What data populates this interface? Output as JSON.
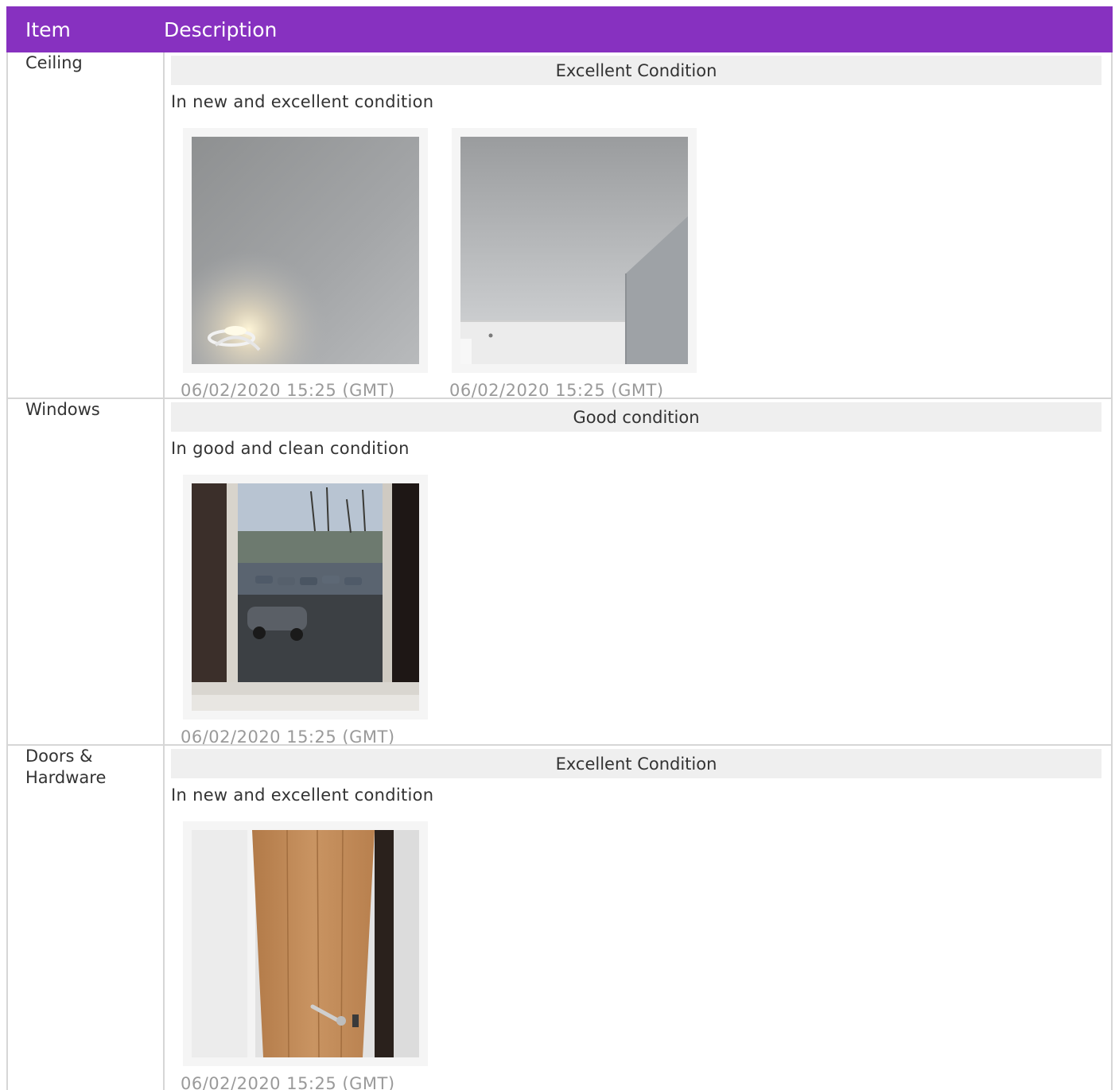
{
  "header": {
    "item_label": "Item",
    "description_label": "Description",
    "accent_color": "#8731c0"
  },
  "rows": [
    {
      "item": "Ceiling",
      "condition": "Excellent Condition",
      "description": "In new and excellent condition",
      "photos": [
        {
          "subject": "ceiling-with-light-fixture",
          "timestamp": "06/02/2020 15:25 (GMT)"
        },
        {
          "subject": "ceiling-corner",
          "timestamp": "06/02/2020 15:25 (GMT)"
        }
      ]
    },
    {
      "item": "Windows",
      "condition": "Good condition",
      "description": "In good and clean condition",
      "photos": [
        {
          "subject": "window-view-car-park",
          "timestamp": "06/02/2020 15:25 (GMT)"
        }
      ]
    },
    {
      "item": "Doors & Hardware",
      "condition": "Excellent Condition",
      "description": "In new and excellent condition",
      "photos": [
        {
          "subject": "oak-door-with-handle",
          "timestamp": "06/02/2020 15:25 (GMT)"
        }
      ]
    }
  ]
}
